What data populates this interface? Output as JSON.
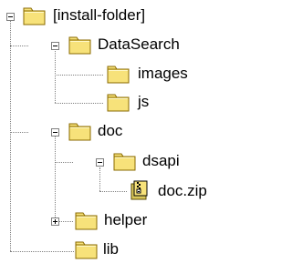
{
  "tree": {
    "nodes": [
      {
        "label": "[install-folder]",
        "icon": "folder-icon",
        "state": "expanded"
      },
      {
        "label": "DataSearch",
        "icon": "folder-icon",
        "state": "expanded"
      },
      {
        "label": "images",
        "icon": "folder-icon",
        "state": "leaf"
      },
      {
        "label": "js",
        "icon": "folder-icon",
        "state": "leaf"
      },
      {
        "label": "doc",
        "icon": "folder-icon",
        "state": "expanded"
      },
      {
        "label": "dsapi",
        "icon": "folder-icon",
        "state": "expanded"
      },
      {
        "label": "doc.zip",
        "icon": "zip-file-icon",
        "state": "leaf"
      },
      {
        "label": "helper",
        "icon": "folder-icon",
        "state": "collapsed"
      },
      {
        "label": "lib",
        "icon": "folder-icon",
        "state": "leaf"
      }
    ],
    "colors": {
      "background": "#ffffff",
      "text": "#000000",
      "folder_fill": "#f7e27a",
      "folder_outline": "#8a6a00",
      "tree_lines": "#808080"
    }
  }
}
